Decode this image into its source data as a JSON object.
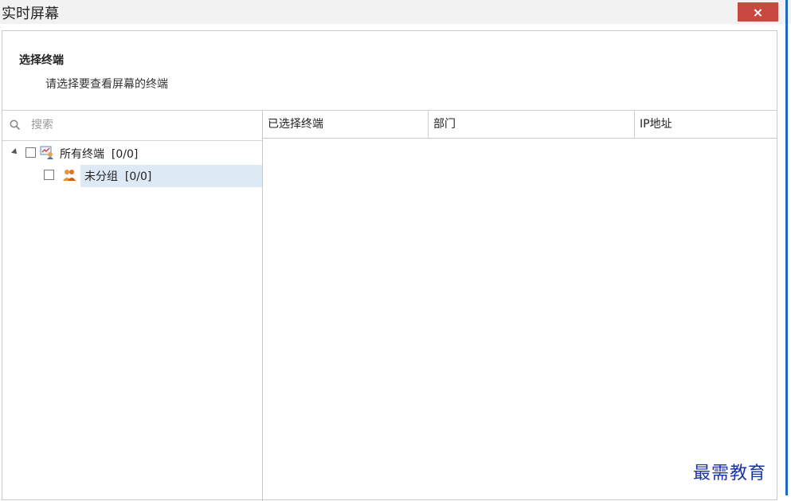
{
  "window": {
    "title": "实时屏幕",
    "close_label": "×"
  },
  "header": {
    "section_title": "选择终端",
    "description": "请选择要查看屏幕的终端"
  },
  "search": {
    "placeholder": "搜索",
    "value": ""
  },
  "tree": {
    "root": {
      "label": "所有终端",
      "count": "[0/0]",
      "icon": "all-terminals-icon",
      "checked": false,
      "expanded": true
    },
    "children": [
      {
        "label": "未分组",
        "count": "[0/0]",
        "icon": "group-users-icon",
        "checked": false,
        "selected": true
      }
    ]
  },
  "table": {
    "columns": [
      "已选择终端",
      "部门",
      "IP地址"
    ],
    "rows": []
  },
  "watermark": "最需教育",
  "colors": {
    "close_button": "#c7493f",
    "selected_row": "#dde9f5",
    "window_edge": "#1e6ac2",
    "watermark": "#1c33a8"
  }
}
